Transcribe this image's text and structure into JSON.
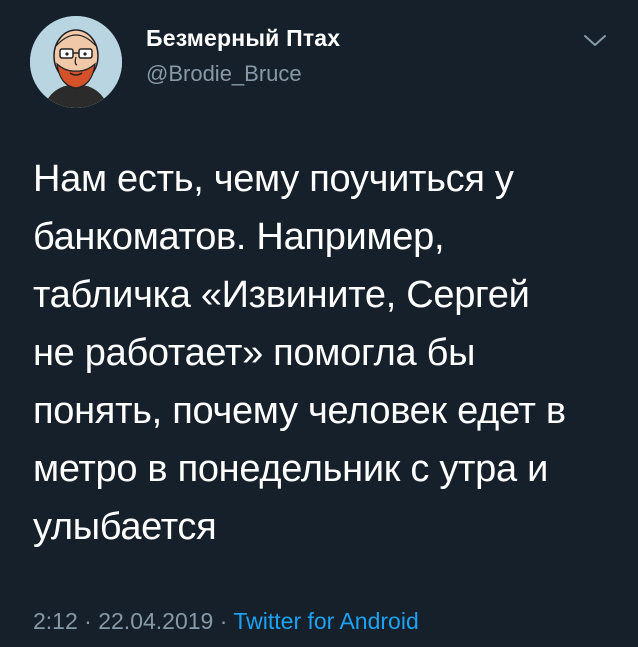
{
  "user": {
    "display_name": "Безмерный Птах",
    "handle": "@Brodie_Bruce",
    "avatar_icon": "cartoon-bearded-man-avatar"
  },
  "menu": {
    "icon": "chevron-down-icon"
  },
  "tweet": {
    "text": "Нам есть, чему поучиться у\nбанкоматов. Например,\nтабличка «Извините, Сергей\nне работает» помогла бы\nпонять, почему человек едет в\nметро в понедельник с утра и\nулыбается",
    "time": "2:12",
    "separator": " · ",
    "date": "22.04.2019",
    "source": "Twitter for Android"
  },
  "colors": {
    "background": "#15202b",
    "secondary_text": "#8899a6",
    "link": "#1da1f2"
  }
}
